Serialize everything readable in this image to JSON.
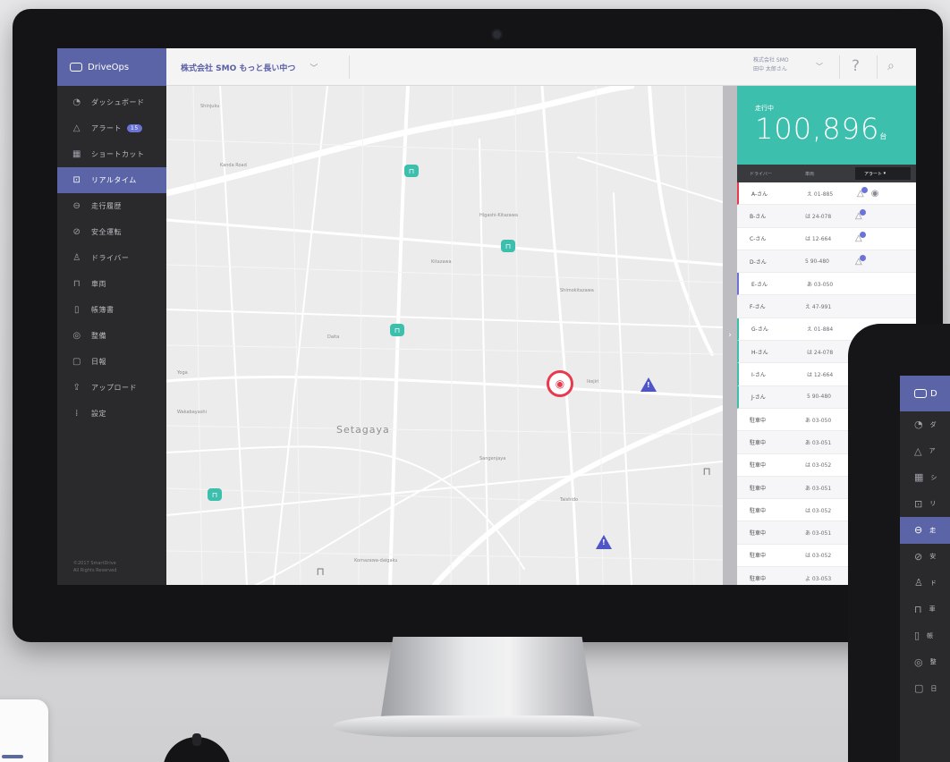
{
  "app": {
    "logo_text": "DriveOps",
    "company": "株式会社 SMO もっと長い中つ",
    "user_company": "株式会社 SMO",
    "user_name": "田中 太郎さん",
    "copyright_line1": "©2017 SmartDrive",
    "copyright_line2": "All Rights Reserved"
  },
  "sidebar": {
    "items": [
      {
        "icon": "dashboard-icon",
        "label": "ダッシュボード"
      },
      {
        "icon": "alert-icon",
        "label": "アラート",
        "badge": "15"
      },
      {
        "icon": "shortcut-icon",
        "label": "ショートカット"
      },
      {
        "icon": "realtime-icon",
        "label": "リアルタイム",
        "active": true
      },
      {
        "icon": "history-icon",
        "label": "走行履歴"
      },
      {
        "icon": "safety-icon",
        "label": "安全運転"
      },
      {
        "icon": "driver-icon",
        "label": "ドライバー"
      },
      {
        "icon": "vehicle-icon",
        "label": "車両"
      },
      {
        "icon": "report-icon",
        "label": "帳簿書"
      },
      {
        "icon": "maintenance-icon",
        "label": "整備"
      },
      {
        "icon": "daily-report-icon",
        "label": "日報"
      },
      {
        "icon": "upload-icon",
        "label": "アップロード"
      },
      {
        "icon": "settings-icon",
        "label": "設定"
      }
    ]
  },
  "map": {
    "district": "Setagaya",
    "labels": [
      "Kanda Road",
      "Shinjuku",
      "Higashi-Kitazawa",
      "Daita",
      "Kitazawa",
      "Shimokitazawa",
      "Ikejiri",
      "Sangenjaya",
      "Taishido",
      "Komazawa-daigaku",
      "Wakabayashi",
      "Yoga"
    ]
  },
  "panel": {
    "status_label": "走行中",
    "count": "100,896",
    "unit": "台",
    "col_driver": "ドライバー",
    "col_vehicle": "車両",
    "col_alert": "アラート",
    "rows": [
      {
        "name": "A-さん",
        "plate": "え 01-885"
      },
      {
        "name": "B-さん",
        "plate": "は 24-078"
      },
      {
        "name": "C-さん",
        "plate": "は 12-664"
      },
      {
        "name": "D-さん",
        "plate": "5 90-480"
      },
      {
        "name": "E-さん",
        "plate": "あ 03-050"
      },
      {
        "name": "F-さん",
        "plate": "え 47-991"
      },
      {
        "name": "G-さん",
        "plate": "え 01-884"
      },
      {
        "name": "H-さん",
        "plate": "は 24-078"
      },
      {
        "name": "I-さん",
        "plate": "は 12-664"
      },
      {
        "name": "J-さん",
        "plate": "5 90-480"
      },
      {
        "name": "駐車中",
        "plate": "あ 03-050"
      },
      {
        "name": "駐車中",
        "plate": "あ 03-051"
      },
      {
        "name": "駐車中",
        "plate": "は 03-052"
      },
      {
        "name": "駐車中",
        "plate": "あ 03-051"
      },
      {
        "name": "駐車中",
        "plate": "は 03-052"
      },
      {
        "name": "駐車中",
        "plate": "あ 03-051"
      },
      {
        "name": "駐車中",
        "plate": "は 03-052"
      },
      {
        "name": "駐車中",
        "plate": "よ 03-053"
      }
    ]
  },
  "tablet": {
    "logo_text": "D",
    "items": [
      "ダ",
      "ア",
      "シ",
      "リ",
      "走",
      "安",
      "ド",
      "車",
      "帳",
      "整",
      "日"
    ]
  },
  "colors": {
    "accent": "#5b64a6",
    "teal": "#3dbfae",
    "alert_red": "#e8394d",
    "warn_purple": "#4f55c7"
  }
}
